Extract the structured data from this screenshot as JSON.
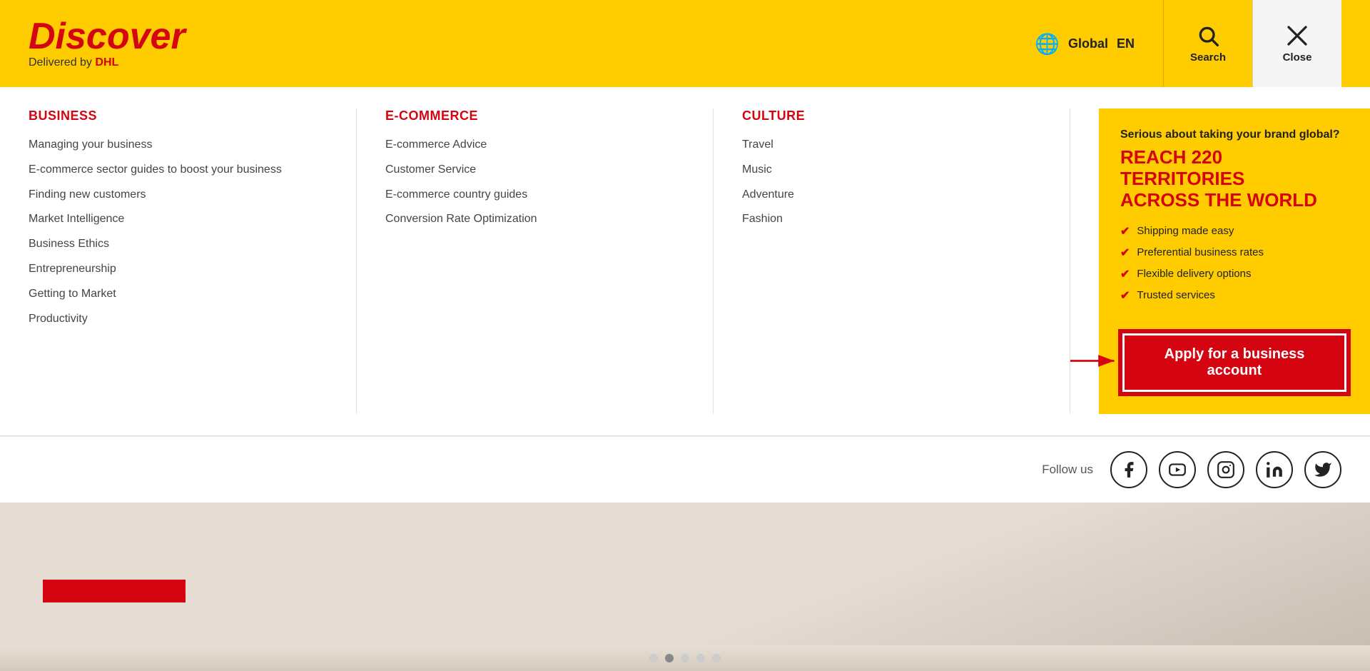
{
  "header": {
    "logo_discover": "Discover",
    "logo_subtitle": "Delivered by",
    "logo_dhl": "DHL",
    "lang_global": "Global",
    "lang_en": "EN",
    "search_label": "Search",
    "close_label": "Close"
  },
  "nav": {
    "columns": [
      {
        "id": "business",
        "header": "BUSINESS",
        "links": [
          "Managing your business",
          "E-commerce sector guides to boost your business",
          "Finding new customers",
          "Market Intelligence",
          "Business Ethics",
          "Entrepreneurship",
          "Getting to Market",
          "Productivity"
        ]
      },
      {
        "id": "ecommerce",
        "header": "E-COMMERCE",
        "links": [
          "E-commerce Advice",
          "Customer Service",
          "E-commerce country guides",
          "Conversion Rate Optimization"
        ]
      },
      {
        "id": "culture",
        "header": "CULTURE",
        "links": [
          "Travel",
          "Music",
          "Adventure",
          "Fashion"
        ]
      }
    ],
    "promo": {
      "tagline": "Serious about taking your brand global?",
      "headline": "REACH 220 TERRITORIES\nACROSS THE WORLD",
      "features": [
        "Shipping made easy",
        "Preferential business rates",
        "Flexible delivery options",
        "Trusted services"
      ],
      "cta_label": "Apply for a business account"
    }
  },
  "social": {
    "follow_label": "Follow us",
    "platforms": [
      "facebook",
      "youtube",
      "instagram",
      "linkedin",
      "twitter"
    ]
  },
  "dots": [
    false,
    true,
    false,
    false,
    false
  ]
}
